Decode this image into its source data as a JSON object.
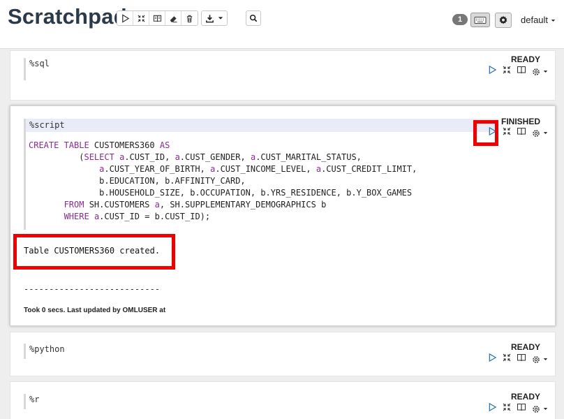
{
  "app": {
    "title": "Scratchpad"
  },
  "toolbar": {
    "run_all": "run-all-icon",
    "show_hide_code": "expand-icon",
    "show_hide_output": "book-icon",
    "clear_output": "eraser-icon",
    "delete": "trash-icon",
    "export": "download-icon",
    "search": "search-icon"
  },
  "header_right": {
    "badge_count": "1",
    "interpreter_label": "default"
  },
  "paragraphs": [
    {
      "code_first": "%sql",
      "status": "READY"
    },
    {
      "code_first": "%script",
      "status": "FINISHED",
      "result": "Table CUSTOMERS360 created.",
      "separator": "---------------------------",
      "footer": "Took 0 secs. Last updated by OMLUSER at"
    },
    {
      "code_first": "%python",
      "status": "READY"
    },
    {
      "code_first": "%r",
      "status": "READY"
    }
  ],
  "colors": {
    "keyword": "#8a2b8f",
    "highlight": "#ee0000",
    "run_icon": "#1f6fb5"
  }
}
